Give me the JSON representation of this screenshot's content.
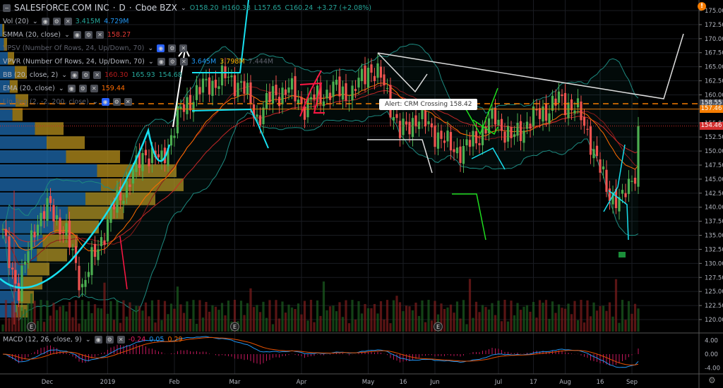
{
  "header": {
    "symbol": "SALESFORCE.COM INC",
    "interval": "D",
    "exchange": "Cboe BZX",
    "open": "O158.20",
    "high": "H160.38",
    "low": "L157.65",
    "close": "C160.24",
    "change": "+3.27 (+2.08%)"
  },
  "indicators": [
    {
      "name": "Vol (20)",
      "values": [
        "3.415M",
        "4.729M"
      ],
      "colors": [
        "#26a69a",
        "#2196f3"
      ],
      "hidden": false
    },
    {
      "name": "SMMA (20, close)",
      "values": [
        "158.27"
      ],
      "colors": [
        "#e53935"
      ],
      "hidden": false
    },
    {
      "name": "VPSV (Number Of Rows, 24, Up/Down, 70)",
      "values": [],
      "colors": [],
      "hidden": true
    },
    {
      "name": "VPVR (Number Of Rows, 24, Up/Down, 70)",
      "values": [
        "3.645M",
        "3.798M",
        "7.444M"
      ],
      "colors": [
        "#2196f3",
        "#ffb300",
        "#5d606b"
      ],
      "hidden": false
    },
    {
      "name": "BB (20, close, 2)",
      "values": [
        "160.30",
        "165.93",
        "154.68"
      ],
      "colors": [
        "#b71c1c",
        "#26a69a",
        "#26a69a"
      ],
      "hidden": false
    },
    {
      "name": "EMA (20, close)",
      "values": [
        "159.44"
      ],
      "colors": [
        "#ff6d00"
      ],
      "hidden": false
    },
    {
      "name": "Lin Reg (2, -2, 200, close)",
      "values": [],
      "colors": [],
      "hidden": true
    }
  ],
  "macd": {
    "name": "MACD (12, 26, close, 9)",
    "values": [
      "-0.24",
      "0.05",
      "0.29"
    ],
    "colors": [
      "#e91e63",
      "#2196f3",
      "#ff6d00"
    ]
  },
  "alert": "Alert: CRM Crossing 158.42",
  "price_labels": [
    {
      "text": "158.55",
      "value": 158.55,
      "color": "#4a4e59"
    },
    {
      "text": "157.46",
      "value": 157.46,
      "color": "#f57c00"
    },
    {
      "text": "154.46",
      "value": 154.46,
      "color": "#d32f2f"
    }
  ],
  "chart_data": {
    "type": "candlestick",
    "title": "SALESFORCE.COM INC · D · Cboe BZX",
    "weekly_closes": [
      135,
      125,
      137,
      140,
      135,
      126,
      133,
      140,
      145,
      150,
      148,
      156,
      160,
      162,
      163,
      162,
      156,
      160,
      161,
      158,
      160,
      161,
      160,
      165,
      162,
      153,
      156,
      154,
      151,
      150,
      153,
      156,
      152,
      155,
      157,
      159,
      158,
      152,
      143,
      141,
      148
    ],
    "last_close": 154.46,
    "alert_level": 158.42,
    "ylim": [
      117.5,
      175
    ],
    "yticks": [
      "175.00",
      "172.50",
      "170.00",
      "167.50",
      "165.00",
      "162.50",
      "160.00",
      "157.50",
      "155.00",
      "152.50",
      "150.00",
      "147.50",
      "145.00",
      "142.50",
      "140.00",
      "137.50",
      "135.00",
      "132.50",
      "130.00",
      "127.50",
      "125.00",
      "122.50",
      "120.00"
    ],
    "macd_yticks": [
      "4.00",
      "0.00",
      "-4.00"
    ],
    "xticks": [
      {
        "label": "Dec",
        "day": 14
      },
      {
        "label": "2019",
        "day": 33
      },
      {
        "label": "Feb",
        "day": 54
      },
      {
        "label": "Mar",
        "day": 73
      },
      {
        "label": "Apr",
        "day": 94
      },
      {
        "label": "May",
        "day": 115
      },
      {
        "label": "16",
        "day": 126
      },
      {
        "label": "Jun",
        "day": 136
      },
      {
        "label": "Jul",
        "day": 156
      },
      {
        "label": "17",
        "day": 167
      },
      {
        "label": "Aug",
        "day": 177
      },
      {
        "label": "16",
        "day": 188
      },
      {
        "label": "Sep",
        "day": 198
      }
    ],
    "earnings_days": [
      9,
      73,
      137
    ]
  }
}
